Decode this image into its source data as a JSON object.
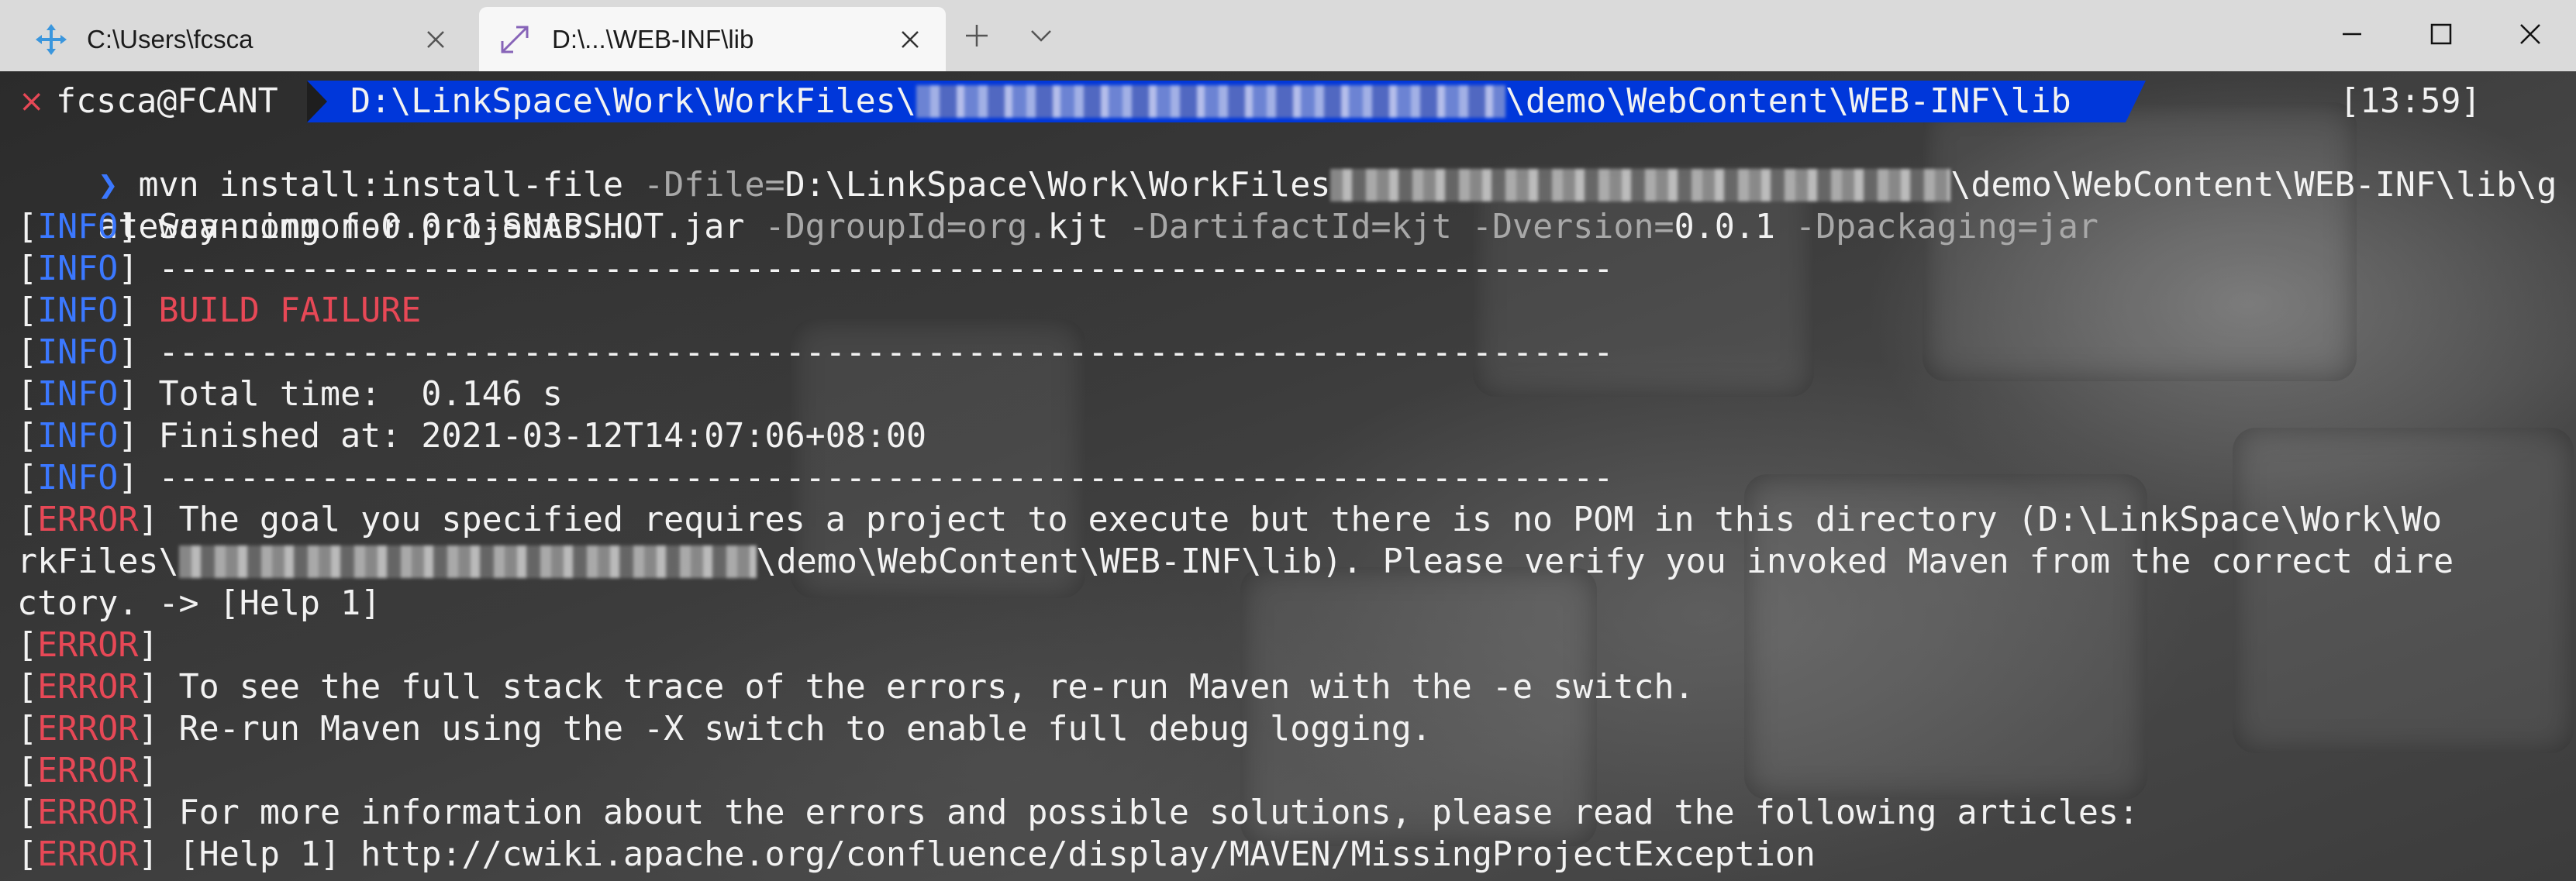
{
  "tabs": [
    {
      "title": "C:\\Users\\fcsca",
      "icon": "azure-cloud-shell-icon",
      "active": false
    },
    {
      "title": "D:\\...\\WEB-INF\\lib",
      "icon": "terminal-expand-icon",
      "active": true
    }
  ],
  "window_controls": {
    "new_tab": "+",
    "dropdown": "chevron-down"
  },
  "prompt": {
    "status_symbol": "×",
    "user_host": "fcsca@FCANT",
    "path_prefix": "D:\\LinkSpace\\Work\\WorkFiles\\",
    "path_suffix": "\\demo\\WebContent\\WEB-INF\\lib",
    "time": "[13:59]"
  },
  "command": {
    "chevron": "❯",
    "cmd": "mvn",
    "arg1": "install:install-file",
    "arg2_flag": "-Dfile=",
    "arg2_value_prefix": "D:\\LinkSpace\\Work\\WorkFiles",
    "arg2_value_suffix": "\\demo\\WebContent\\WEB-INF\\lib\\g",
    "wrap_line": "ateway-common-0.0.1-SNAPSHOT.jar",
    "groupid_flag": "-DgroupId=",
    "groupid_val_a": "org.",
    "groupid_val_b": "kjt",
    "artifact_flag": "-DartifactId=kjt",
    "version_flag": "-Dversion=",
    "version_val": "0.0.1",
    "packaging_flag": "-Dpackaging=jar"
  },
  "output": [
    {
      "level": "INFO",
      "text": " Scanning for projects..."
    },
    {
      "level": "INFO",
      "text": " ------------------------------------------------------------------------"
    },
    {
      "level": "INFO",
      "text": " BUILD FAILURE",
      "style": "error"
    },
    {
      "level": "INFO",
      "text": " ------------------------------------------------------------------------"
    },
    {
      "level": "INFO",
      "text": " Total time:  0.146 s"
    },
    {
      "level": "INFO",
      "text": " Finished at: 2021-03-12T14:07:06+08:00"
    },
    {
      "level": "INFO",
      "text": " ------------------------------------------------------------------------"
    },
    {
      "level": "ERROR",
      "text": " The goal you specified requires a project to execute but there is no POM in this directory (D:\\LinkSpace\\Work\\Wo"
    },
    {
      "level": "",
      "text_prefix": "rkFiles\\",
      "text_suffix": "\\demo\\WebContent\\WEB-INF\\lib). Please verify you invoked Maven from the correct dire"
    },
    {
      "level": "",
      "text": "ctory. -> [Help 1]"
    },
    {
      "level": "ERROR",
      "text": ""
    },
    {
      "level": "ERROR",
      "text": " To see the full stack trace of the errors, re-run Maven with the -e switch."
    },
    {
      "level": "ERROR",
      "text": " Re-run Maven using the -X switch to enable full debug logging."
    },
    {
      "level": "ERROR",
      "text": ""
    },
    {
      "level": "ERROR",
      "text": " For more information about the errors and possible solutions, please read the following articles:"
    },
    {
      "level": "ERROR",
      "text": " [Help 1] http://cwiki.apache.org/confluence/display/MAVEN/MissingProjectException"
    }
  ],
  "colors": {
    "info": "#3b78ff",
    "error": "#e74856",
    "path_bg": "#0037da",
    "text": "#f2f2f2",
    "dim": "#a8a8a8"
  }
}
